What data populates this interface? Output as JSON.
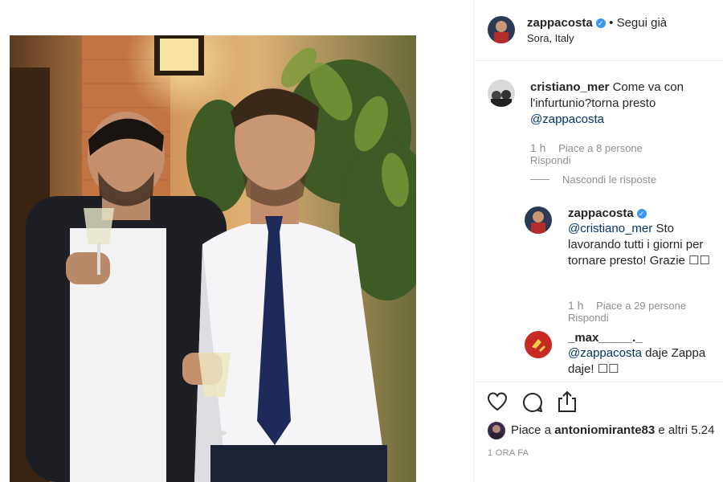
{
  "post": {
    "author": "zappacosta",
    "follow_status": "• Segui già",
    "location": "Sora, Italy",
    "time_ago": "1 ORA FA",
    "likes_prefix": "Piace a ",
    "likes_user": "antoniomirante83",
    "likes_suffix": " e altri 5.24"
  },
  "comments": [
    {
      "user": "cristiano_mer",
      "text": "Come va con l'infurtunio?torna presto",
      "mention": "@zappacosta",
      "age": "1 h",
      "likes": "Piace a 8 persone",
      "reply_label": "Rispondi",
      "toggle_replies": "Nascondi le risposte"
    }
  ],
  "replies": [
    {
      "user": "zappacosta",
      "mention": "@cristiano_mer",
      "text": "Sto lavorando tutti i giorni per tornare presto! Grazie",
      "emoji": "☐☐",
      "age": "1 h",
      "likes": "Piace a 29 persone",
      "reply_label": "Rispondi"
    },
    {
      "user": "_max_____._",
      "mention": "@zappacosta",
      "text": "daje Zappa daje!",
      "emoji": "☐☐"
    }
  ],
  "icons": [
    "heart-icon",
    "comment-icon",
    "share-icon"
  ],
  "colors": {
    "verified": "#3897f0",
    "mention": "#003569",
    "muted": "#8e8e8e"
  }
}
